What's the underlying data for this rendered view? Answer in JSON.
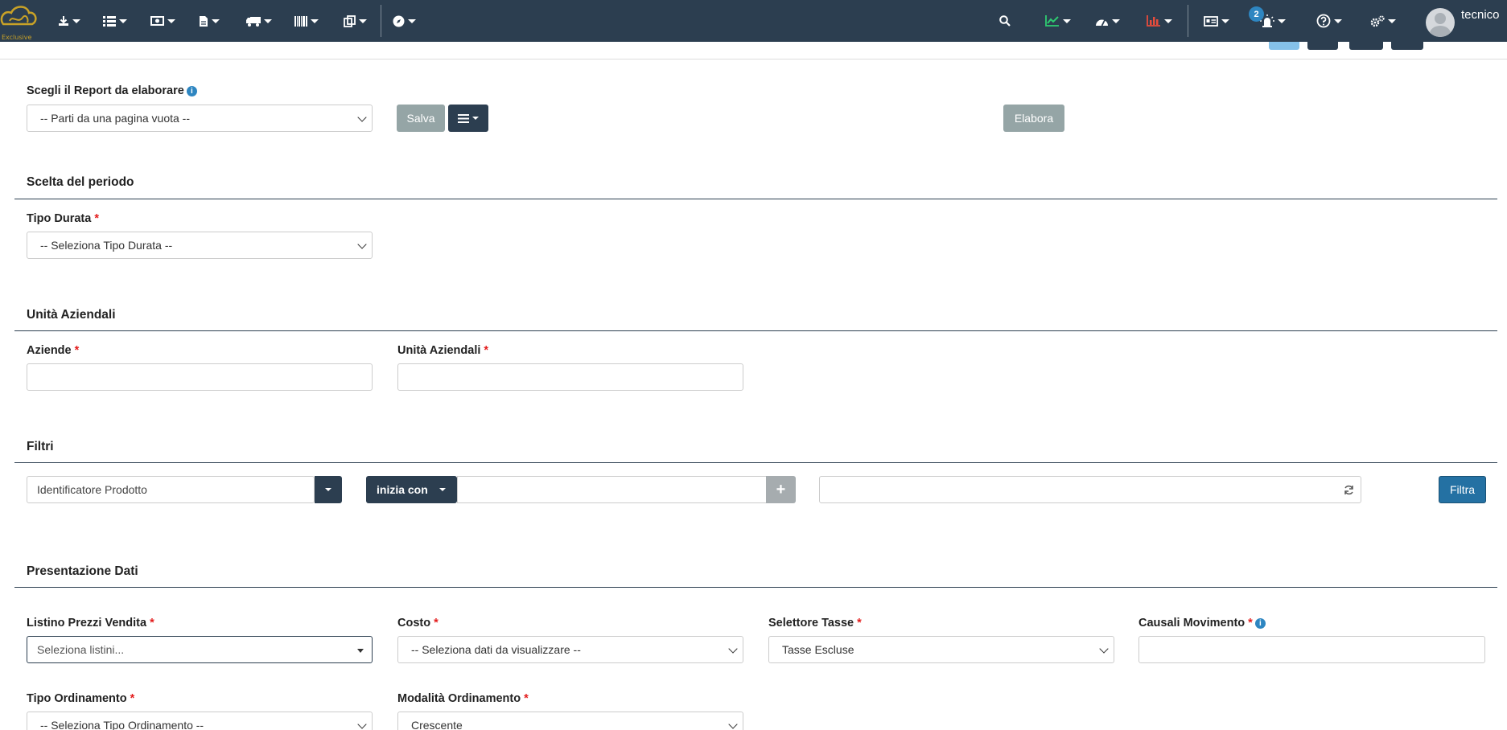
{
  "brand": {
    "logo_text": "Exclusive"
  },
  "navbar": {
    "notifications_count": "2",
    "username": "tecnico"
  },
  "report": {
    "label": "Scegli il Report da elaborare",
    "select_value": "-- Parti da una pagina vuota --",
    "save_label": "Salva",
    "process_label": "Elabora"
  },
  "period": {
    "title": "Scelta del periodo",
    "duration_label": "Tipo Durata",
    "duration_value": "-- Seleziona Tipo Durata --"
  },
  "units": {
    "title": "Unità Aziendali",
    "companies_label": "Aziende",
    "units_label": "Unità Aziendali"
  },
  "filters": {
    "title": "Filtri",
    "field_value": "Identificatore Prodotto",
    "operator_label": "inizia con",
    "filter_label": "Filtra"
  },
  "presentation": {
    "title": "Presentazione Dati",
    "price_list_label": "Listino Prezzi Vendita",
    "price_list_placeholder": "Seleziona listini...",
    "cost_label": "Costo",
    "cost_value": "-- Seleziona dati da visualizzare --",
    "tax_label": "Selettore Tasse",
    "tax_value": "Tasse Escluse",
    "causal_label": "Causali Movimento",
    "sort_type_label": "Tipo Ordinamento",
    "sort_type_value": "-- Seleziona Tipo Ordinamento --",
    "sort_mode_label": "Modalità Ordinamento",
    "sort_mode_value": "Crescente"
  }
}
